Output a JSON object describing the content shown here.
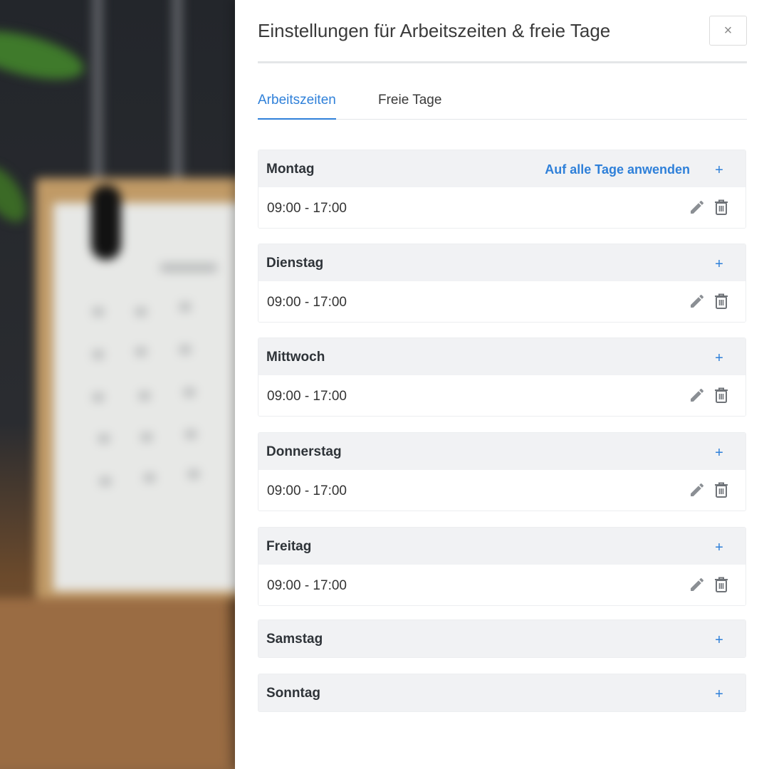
{
  "panel": {
    "title": "Einstellungen für Arbeitszeiten & freie Tage",
    "close_label": "×"
  },
  "tabs": [
    {
      "label": "Arbeitszeiten",
      "active": true
    },
    {
      "label": "Freie Tage",
      "active": false
    }
  ],
  "apply_all_label": "Auf alle Tage anwenden",
  "add_label": "+",
  "days": [
    {
      "name": "Montag",
      "times": [
        "09:00 - 17:00"
      ]
    },
    {
      "name": "Dienstag",
      "times": [
        "09:00 - 17:00"
      ]
    },
    {
      "name": "Mittwoch",
      "times": [
        "09:00 - 17:00"
      ]
    },
    {
      "name": "Donnerstag",
      "times": [
        "09:00 - 17:00"
      ]
    },
    {
      "name": "Freitag",
      "times": [
        "09:00 - 17:00"
      ]
    },
    {
      "name": "Samstag",
      "times": []
    },
    {
      "name": "Sonntag",
      "times": []
    }
  ],
  "icons": {
    "edit": "pencil-icon",
    "delete": "trash-icon",
    "add": "plus-icon",
    "close": "close-icon"
  },
  "colors": {
    "accent": "#2f80d9",
    "header_bg": "#f1f2f4",
    "icon_gray": "#8b8f94"
  }
}
